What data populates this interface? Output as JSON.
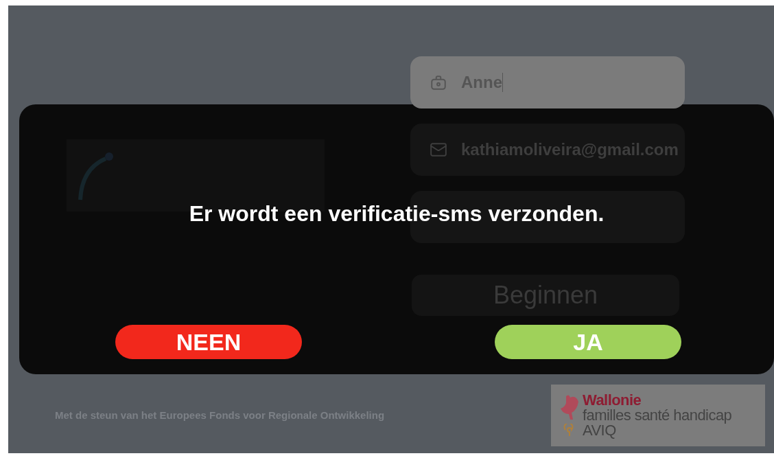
{
  "form": {
    "fields": [
      {
        "kind": "name",
        "value": "Anne",
        "focused": true
      },
      {
        "kind": "email",
        "value": "kathiamoliveira@gmail.com",
        "focused": false
      },
      {
        "focused": false
      }
    ],
    "submit_button": "Beginnen"
  },
  "logos": {
    "aviq": {
      "line_1": "Wallonie",
      "line_2": "familles santé handicap",
      "line_3": "AVIQ"
    }
  },
  "footer": {
    "text": "Met de steun van het Europees Fonds voor Regionale Ontwikkeling"
  },
  "dialog": {
    "message": "Er wordt een verificatie-sms verzonden.",
    "buttons": [
      {
        "label": "NEEN",
        "kind": "cancel"
      },
      {
        "label": "JA",
        "kind": "confirm"
      }
    ]
  }
}
